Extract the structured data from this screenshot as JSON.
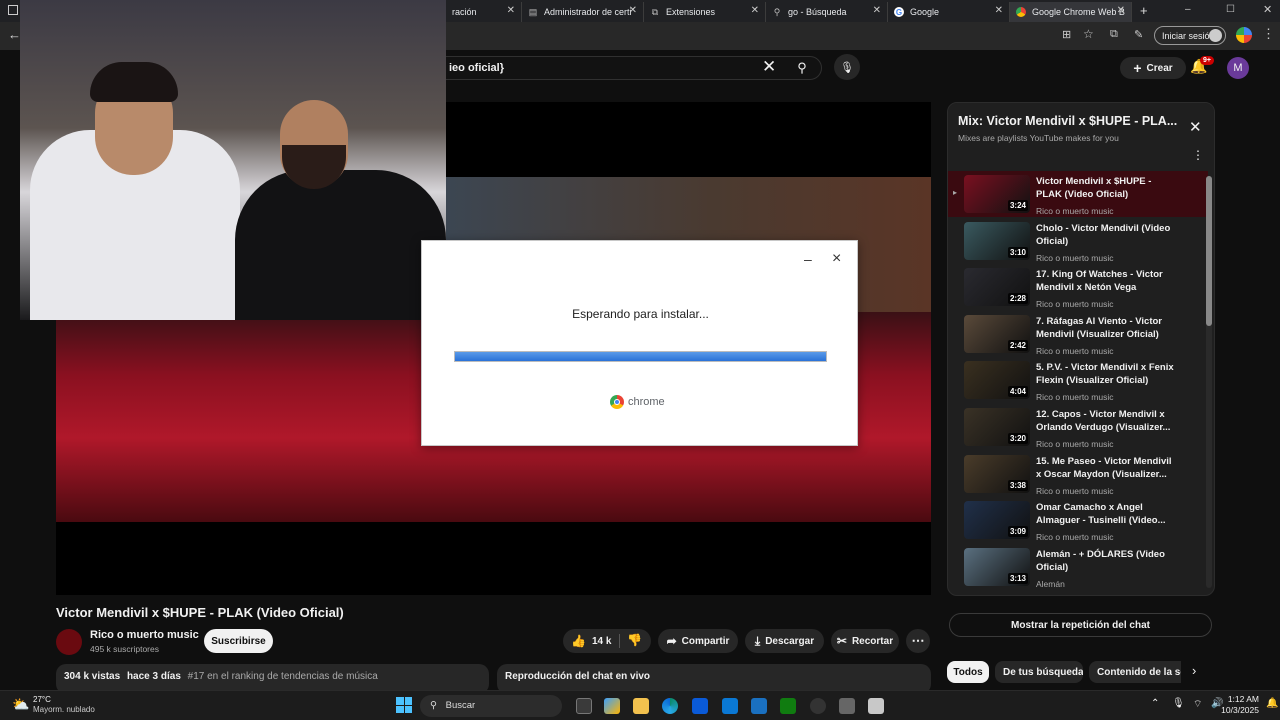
{
  "browser": {
    "tabs": [
      {
        "label": "ración",
        "icon": "generic-tab-icon"
      },
      {
        "label": "Administrador de certi",
        "icon": "page-icon"
      },
      {
        "label": "Extensiones",
        "icon": "puzzle-icon"
      },
      {
        "label": "go - Búsqueda",
        "icon": "search-icon"
      },
      {
        "label": "Google",
        "icon": "google-icon"
      },
      {
        "label": "Google Chrome Web B",
        "icon": "chrome-icon"
      }
    ],
    "new_tab": "+",
    "signin_label": "Iniciar sesión",
    "profile_initial": "M"
  },
  "youtube": {
    "search_value": "ieo oficial}",
    "create_label": "Crear",
    "notification_count": "9+",
    "avatar_initial": "M"
  },
  "dialog": {
    "title": "Esperando para instalar...",
    "brand": "chrome",
    "progress": 1.0,
    "minimize_glyph": "–",
    "close_glyph": "×"
  },
  "video": {
    "title": "Victor Mendivil x $HUPE - PLAK (Video Oficial)",
    "channel": "Rico o muerto music",
    "subscribers": "495 k suscriptores",
    "subscribe_label": "Suscribirse",
    "likes": "14 k",
    "share_label": "Compartir",
    "download_label": "Descargar",
    "clip_label": "Recortar",
    "views": "304 k vistas",
    "age": "hace 3 días",
    "ranking": "#17 en el ranking de tendencias de música",
    "chat_replay_panel": "Reproducción del chat en vivo"
  },
  "playlist": {
    "title": "Mix: Victor Mendivil x $HUPE - PLA...",
    "subtitle": "Mixes are playlists YouTube makes for you",
    "items": [
      {
        "title": "Victor Mendivil x $HUPE - PLAK (Video Oficial)",
        "channel": "Rico o muerto music",
        "duration": "3:24",
        "thumb": "#7a1020",
        "playing": true
      },
      {
        "title": "Cholo - Victor Mendivil (Video Oficial)",
        "channel": "Rico o muerto music",
        "duration": "3:10",
        "thumb": "#3a5a60",
        "playing": false
      },
      {
        "title": "17. King Of Watches - Victor Mendivil x Netón Vega",
        "channel": "Rico o muerto music",
        "duration": "2:28",
        "thumb": "#2a2a30",
        "playing": false
      },
      {
        "title": "7. Ráfagas Al Viento - Victor Mendivil (Visualizer Oficial)",
        "channel": "Rico o muerto music",
        "duration": "2:42",
        "thumb": "#5a4a3a",
        "playing": false
      },
      {
        "title": "5. P.V. - Victor Mendivil x Fenix Flexin (Visualizer Oficial)",
        "channel": "Rico o muerto music",
        "duration": "4:04",
        "thumb": "#3a3020",
        "playing": false
      },
      {
        "title": "12. Capos - Victor Mendivil x Orlando Verdugo (Visualizer...",
        "channel": "Rico o muerto music",
        "duration": "3:20",
        "thumb": "#3a3226",
        "playing": false
      },
      {
        "title": "15. Me Paseo - Victor Mendivil x Oscar Maydon (Visualizer...",
        "channel": "Rico o muerto music",
        "duration": "3:38",
        "thumb": "#4a3c2a",
        "playing": false
      },
      {
        "title": "Omar Camacho x Angel Almaguer - Tusinelli (Video...",
        "channel": "Rico o muerto music",
        "duration": "3:09",
        "thumb": "#20304a",
        "playing": false
      },
      {
        "title": "Alemán - + DÓLARES (Video Oficial)",
        "channel": "Alemán",
        "duration": "3:13",
        "thumb": "#5a7080",
        "playing": false
      }
    ],
    "show_chat_label": "Mostrar la repetición del chat"
  },
  "chips": [
    "Todos",
    "De tus búsquedas",
    "Contenido de la ser"
  ],
  "taskbar": {
    "weather_temp": "27°C",
    "weather_desc": "Mayorm. nublado",
    "search_label": "Buscar",
    "time": "1:12 AM",
    "date": "10/3/2025"
  },
  "colors": {
    "accent_red": "#ff0033",
    "progress_blue": "#2a72d8",
    "yt_bg": "#0f0f0f"
  }
}
